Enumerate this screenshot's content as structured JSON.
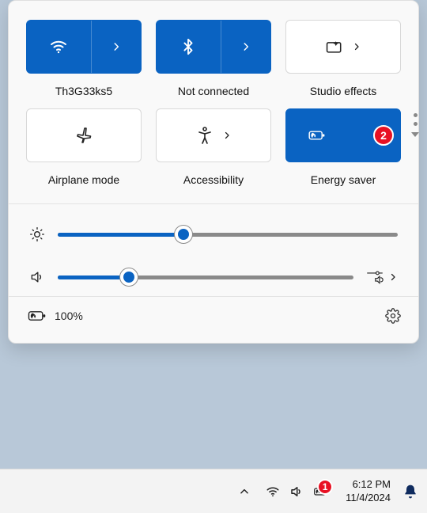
{
  "colors": {
    "accent": "#0a63c2",
    "badge": "#e81123"
  },
  "quick_settings": {
    "tiles": [
      {
        "id": "wifi",
        "label": "Th3G33ks5",
        "active": true,
        "expandable": true
      },
      {
        "id": "bluetooth",
        "label": "Not connected",
        "active": true,
        "expandable": true
      },
      {
        "id": "studio-effects",
        "label": "Studio effects",
        "active": false,
        "expandable": true
      },
      {
        "id": "airplane-mode",
        "label": "Airplane mode",
        "active": false,
        "expandable": false
      },
      {
        "id": "accessibility",
        "label": "Accessibility",
        "active": false,
        "expandable": true
      },
      {
        "id": "energy-saver",
        "label": "Energy saver",
        "active": true,
        "expandable": false,
        "badge": "2"
      }
    ],
    "sliders": {
      "brightness": {
        "percent": 37
      },
      "volume": {
        "percent": 24
      }
    },
    "battery": {
      "text": "100%"
    }
  },
  "taskbar": {
    "battery_badge": "1",
    "clock": {
      "time": "6:12 PM",
      "date": "11/4/2024"
    }
  }
}
